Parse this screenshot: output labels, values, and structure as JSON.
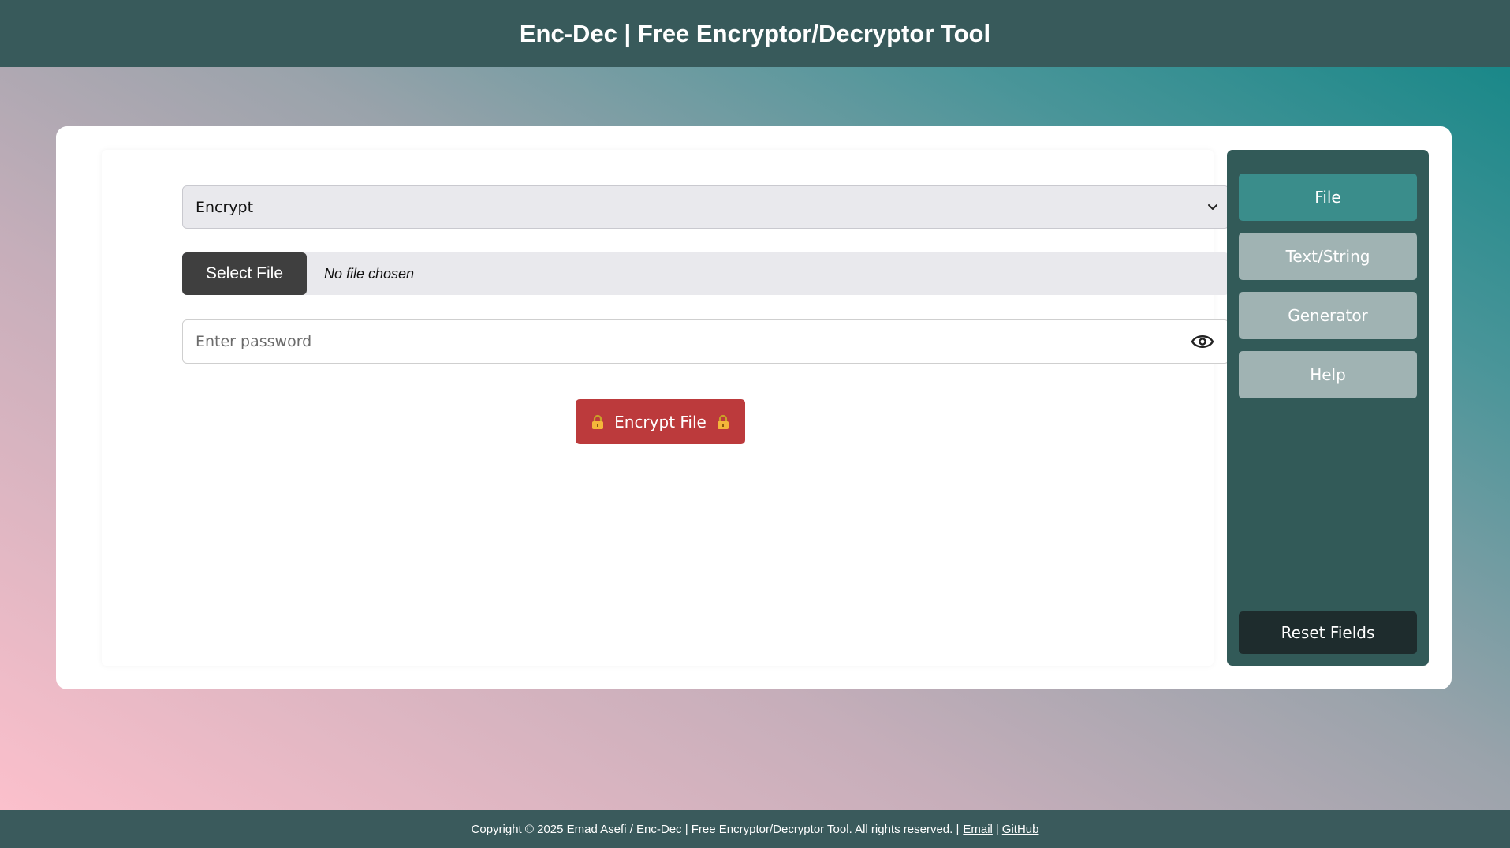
{
  "header": {
    "title": "Enc-Dec | Free Encryptor/Decryptor Tool"
  },
  "main": {
    "mode_select": {
      "value": "Encrypt",
      "icon": "chevron-down-icon"
    },
    "file_input": {
      "button_label": "Select File",
      "status": "No file chosen"
    },
    "password": {
      "placeholder": "Enter password",
      "value": "",
      "icon": "eye-icon"
    },
    "action_button": {
      "label": "Encrypt File",
      "icon": "lock-icon"
    }
  },
  "sidebar": {
    "tabs": [
      {
        "label": "File",
        "active": true
      },
      {
        "label": "Text/String",
        "active": false
      },
      {
        "label": "Generator",
        "active": false
      },
      {
        "label": "Help",
        "active": false
      }
    ],
    "reset_label": "Reset Fields"
  },
  "footer": {
    "copyright": "Copyright © 2025 Emad Asefi / Enc-Dec | Free Encryptor/Decryptor Tool. All rights reserved. |",
    "email_label": "Email",
    "separator": "|",
    "github_label": "GitHub"
  },
  "colors": {
    "header_bg": "#385a5b",
    "sidebar_bg": "#325a58",
    "active_tab": "#3a8d8b",
    "inactive_tab": "#a0b3b3",
    "encrypt_button": "#bc3a3c",
    "reset_button": "#1e2c2d"
  }
}
